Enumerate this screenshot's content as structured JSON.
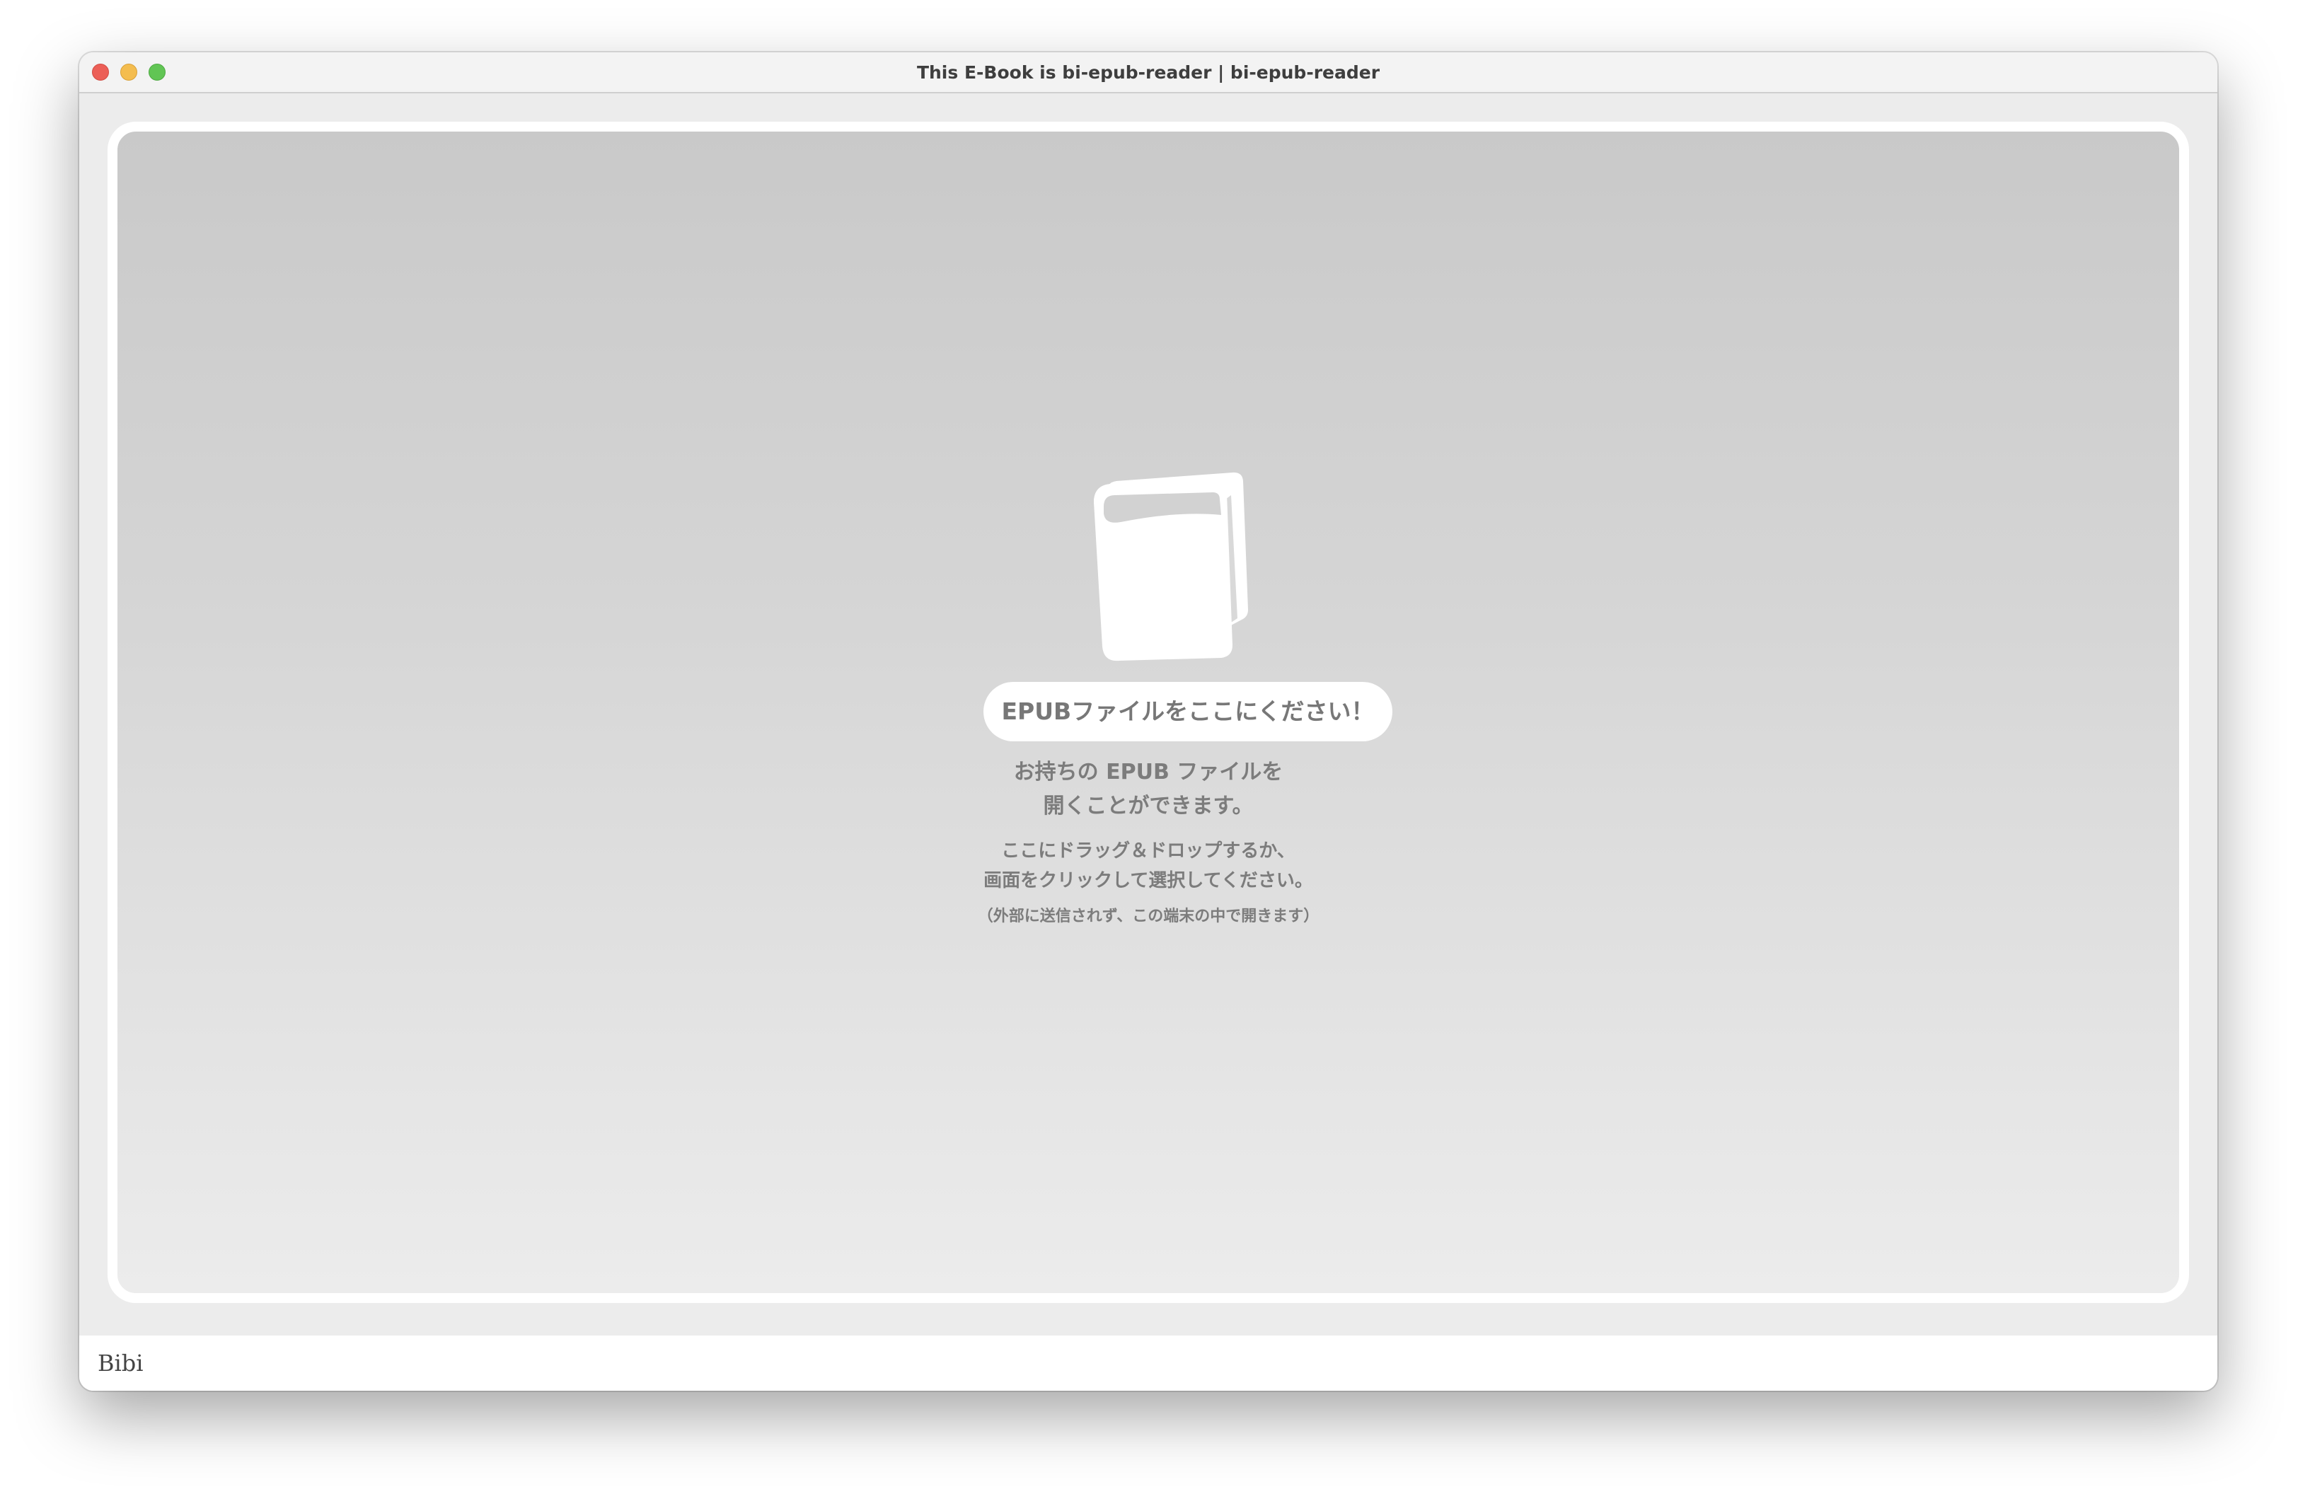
{
  "window": {
    "title": "This E-Book is bi-epub-reader | bi-epub-reader"
  },
  "dropzone": {
    "icon": "book-icon",
    "headline": "EPUBファイルをここにください！",
    "description_line1": "お持ちの EPUB ファイルを",
    "description_line2": "開くことができます。",
    "instruction_line1": "ここにドラッグ＆ドロップするか、",
    "instruction_line2": "画面をクリックして選択してください。",
    "note": "（外部に送信されず、この端末の中で開きます）"
  },
  "footer": {
    "brand": "Bibi"
  },
  "colors": {
    "close": "#ec5f57",
    "minimize": "#f4bd4f",
    "maximize": "#61c554",
    "text_gray": "#7c7c7c"
  }
}
